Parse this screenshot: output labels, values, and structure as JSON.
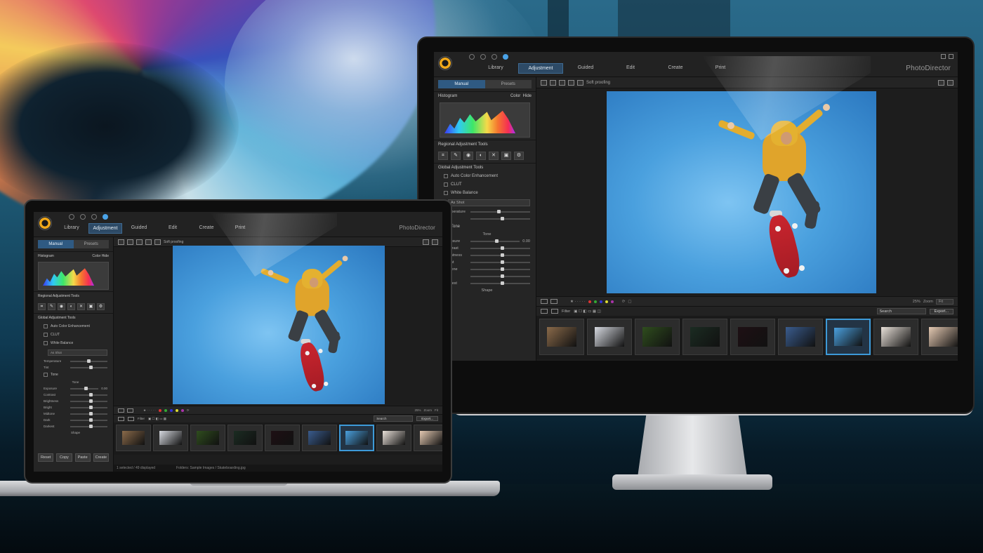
{
  "app": {
    "brand": "PhotoDirector",
    "tabs": [
      "Library",
      "Adjustment",
      "Guided",
      "Edit",
      "Create",
      "Print"
    ],
    "active_tab": "Adjustment",
    "mode_tabs": [
      "Manual",
      "Presets"
    ],
    "active_mode": "Manual"
  },
  "panel": {
    "histogram": {
      "title": "Histogram",
      "color_label": "Color",
      "hide_label": "Hide"
    },
    "regional": {
      "title": "Regional Adjustment Tools"
    },
    "global": {
      "title": "Global Adjustment Tools",
      "items": [
        "Auto Color Enhancement",
        "CLUT"
      ]
    },
    "white_balance": {
      "title": "White Balance",
      "preset": "As Shot",
      "sliders": [
        "Temperature",
        "Tint"
      ]
    },
    "tone": {
      "title": "Tone",
      "subtitle": "Tone",
      "sliders": [
        "Exposure",
        "Contrast"
      ],
      "exposure_value": "0.00",
      "more_sliders": [
        "Brightness",
        "Bright",
        "Midtone",
        "Dark",
        "Darkest"
      ]
    },
    "next_section": "Shape",
    "bottom_buttons": [
      "Reset",
      "Copy",
      "Paste",
      "Create"
    ]
  },
  "main": {
    "soft_proofing": "Soft proofing",
    "viewbar": {
      "zoom_value": "25%",
      "zoom_label": "Zoom",
      "fit": "Fit"
    },
    "filterbar": {
      "filter_label": "Filter",
      "search_placeholder": "Search",
      "export_label": "Export..."
    },
    "status": {
      "selection": "1 selected / 49 displayed",
      "folder": "Folders: Sample Images / Skateboarding.jpg"
    }
  },
  "filmstrip": {
    "colors": [
      "#8a6a4a",
      "#d6d9e0",
      "#2f4d1e",
      "#1b2c22",
      "#1e1014",
      "#3a5c8e",
      "#4aa0de",
      "#e8e0d8",
      "#e4c9b2"
    ],
    "selected_index": 6
  },
  "icons": {
    "logo": "photodirector-logo",
    "nav": [
      "back-icon",
      "forward-icon",
      "home-icon",
      "help-icon"
    ]
  }
}
